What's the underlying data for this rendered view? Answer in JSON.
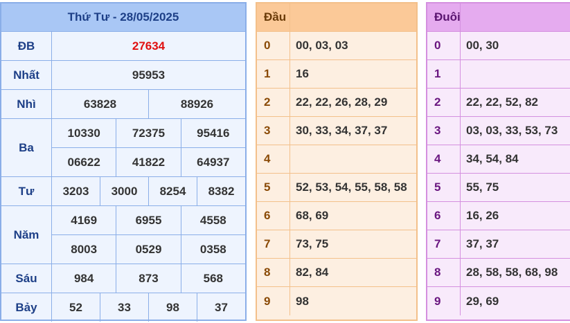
{
  "results": {
    "title": "Thứ Tư - 28/05/2025",
    "prizes": [
      {
        "label": "ĐB",
        "rows": [
          [
            "27634"
          ]
        ],
        "special": true
      },
      {
        "label": "Nhất",
        "rows": [
          [
            "95953"
          ]
        ]
      },
      {
        "label": "Nhì",
        "rows": [
          [
            "63828",
            "88926"
          ]
        ]
      },
      {
        "label": "Ba",
        "rows": [
          [
            "10330",
            "72375",
            "95416"
          ],
          [
            "06622",
            "41822",
            "64937"
          ]
        ]
      },
      {
        "label": "Tư",
        "rows": [
          [
            "3203",
            "3000",
            "8254",
            "8382"
          ]
        ]
      },
      {
        "label": "Năm",
        "rows": [
          [
            "4169",
            "6955",
            "4558"
          ],
          [
            "8003",
            "0529",
            "0358"
          ]
        ]
      },
      {
        "label": "Sáu",
        "rows": [
          [
            "984",
            "873",
            "568"
          ]
        ]
      },
      {
        "label": "Bảy",
        "rows": [
          [
            "52",
            "33",
            "98",
            "37"
          ]
        ]
      }
    ]
  },
  "dau": {
    "header": "Đầu",
    "rows": [
      {
        "key": "0",
        "value": "00, 03, 03"
      },
      {
        "key": "1",
        "value": "16"
      },
      {
        "key": "2",
        "value": "22, 22, 26, 28, 29"
      },
      {
        "key": "3",
        "value": "30, 33, 34, 37, 37"
      },
      {
        "key": "4",
        "value": ""
      },
      {
        "key": "5",
        "value": "52, 53, 54, 55, 58, 58"
      },
      {
        "key": "6",
        "value": "68, 69"
      },
      {
        "key": "7",
        "value": "73, 75"
      },
      {
        "key": "8",
        "value": "82, 84"
      },
      {
        "key": "9",
        "value": "98"
      }
    ]
  },
  "duoi": {
    "header": "Đuôi",
    "rows": [
      {
        "key": "0",
        "value": "00, 30"
      },
      {
        "key": "1",
        "value": ""
      },
      {
        "key": "2",
        "value": "22, 22, 52, 82"
      },
      {
        "key": "3",
        "value": "03, 03, 33, 53, 73"
      },
      {
        "key": "4",
        "value": "34, 54, 84"
      },
      {
        "key": "5",
        "value": "55, 75"
      },
      {
        "key": "6",
        "value": "16, 26"
      },
      {
        "key": "7",
        "value": "37, 37"
      },
      {
        "key": "8",
        "value": "28, 58, 58, 68, 98"
      },
      {
        "key": "9",
        "value": "29, 69"
      }
    ]
  },
  "colors": {
    "results_border": "#8aaee8",
    "results_header": "#a9c7f5",
    "special_prize": "#e01010",
    "dau_header": "#fbc998",
    "duoi_header": "#e5abef"
  }
}
